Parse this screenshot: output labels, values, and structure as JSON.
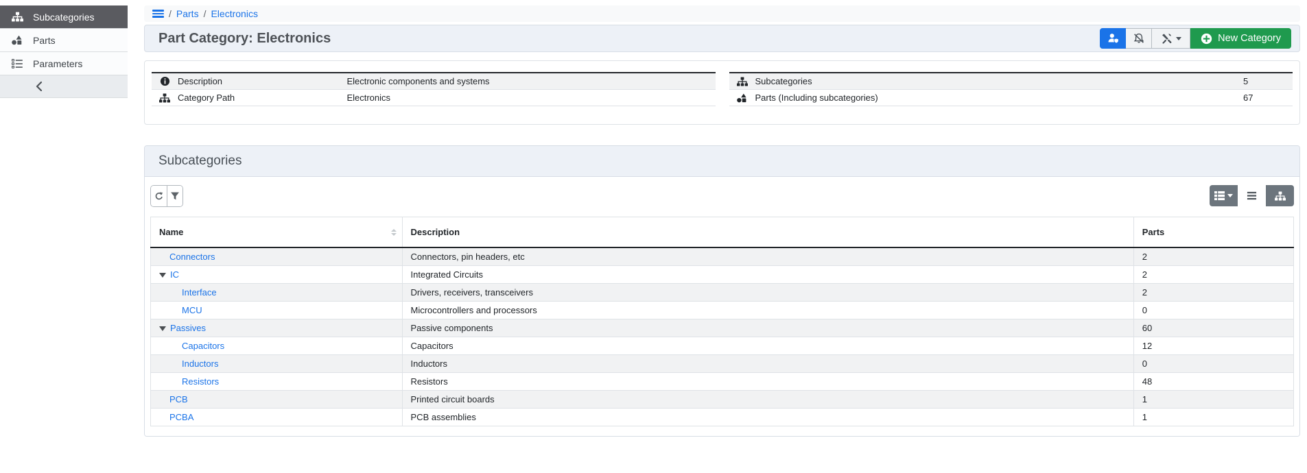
{
  "colors": {
    "primary": "#1a73e8",
    "success": "#1f9a4e",
    "link": "#1a73e8",
    "sidebar_active_bg": "#5a5b60",
    "panel_header_bg": "#edf1f7",
    "stripe": "#f1f2f3"
  },
  "sidebar": {
    "items": [
      {
        "label": "Subcategories",
        "icon": "sitemap-icon",
        "active": true
      },
      {
        "label": "Parts",
        "icon": "shapes-icon",
        "active": false
      },
      {
        "label": "Parameters",
        "icon": "list-tasks-icon",
        "active": false
      }
    ],
    "collapse_icon": "chevron-left-icon"
  },
  "breadcrumb": {
    "menu_icon": "hamburger-icon",
    "separator1": "/",
    "separator2": "/",
    "links": [
      {
        "label": "Parts"
      },
      {
        "label": "Electronics"
      }
    ]
  },
  "header": {
    "title": "Part Category: Electronics",
    "buttons": [
      {
        "name": "user-permissions",
        "icon": "user-shield-icon"
      },
      {
        "name": "hide",
        "icon": "bell-slash-icon"
      },
      {
        "name": "tools-menu",
        "icon": "tools-icon",
        "has_caret": true
      },
      {
        "name": "new-category",
        "icon": "plus-circle-icon",
        "label": "New Category"
      }
    ]
  },
  "info_panels": {
    "details": {
      "rows": [
        {
          "icon": "info-circle-icon",
          "label": "Description",
          "value": "Electronic components and systems"
        },
        {
          "icon": "sitemap-icon",
          "label": "Category Path",
          "value": "Electronics"
        }
      ]
    },
    "counts": {
      "rows": [
        {
          "icon": "sitemap-icon",
          "label": "Subcategories",
          "value": "5"
        },
        {
          "icon": "shapes-icon",
          "label": "Parts (Including subcategories)",
          "value": "67"
        }
      ]
    }
  },
  "subcategories_panel": {
    "title": "Subcategories",
    "toolbar": {
      "left": [
        {
          "name": "refresh",
          "icon": "refresh-icon"
        },
        {
          "name": "filter",
          "icon": "filter-icon"
        }
      ],
      "views": [
        {
          "name": "table-view",
          "icon": "table-icon",
          "has_caret": true,
          "active": false
        },
        {
          "name": "list-view",
          "icon": "list-icon",
          "active": true
        },
        {
          "name": "tree-view",
          "icon": "sitemap-icon",
          "active": false
        }
      ]
    },
    "table": {
      "columns": [
        "Name",
        "Description",
        "Parts"
      ],
      "rows": [
        {
          "name": "Connectors",
          "description": "Connectors, pin headers, etc",
          "parts": "2",
          "depth": 0,
          "expandable": false
        },
        {
          "name": "IC",
          "description": "Integrated Circuits",
          "parts": "2",
          "depth": 0,
          "expandable": true
        },
        {
          "name": "Interface",
          "description": "Drivers, receivers, transceivers",
          "parts": "2",
          "depth": 1,
          "expandable": false
        },
        {
          "name": "MCU",
          "description": "Microcontrollers and processors",
          "parts": "0",
          "depth": 1,
          "expandable": false
        },
        {
          "name": "Passives",
          "description": "Passive components",
          "parts": "60",
          "depth": 0,
          "expandable": true
        },
        {
          "name": "Capacitors",
          "description": "Capacitors",
          "parts": "12",
          "depth": 1,
          "expandable": false
        },
        {
          "name": "Inductors",
          "description": "Inductors",
          "parts": "0",
          "depth": 1,
          "expandable": false
        },
        {
          "name": "Resistors",
          "description": "Resistors",
          "parts": "48",
          "depth": 1,
          "expandable": false
        },
        {
          "name": "PCB",
          "description": "Printed circuit boards",
          "parts": "1",
          "depth": 0,
          "expandable": false
        },
        {
          "name": "PCBA",
          "description": "PCB assemblies",
          "parts": "1",
          "depth": 0,
          "expandable": false
        }
      ]
    }
  }
}
